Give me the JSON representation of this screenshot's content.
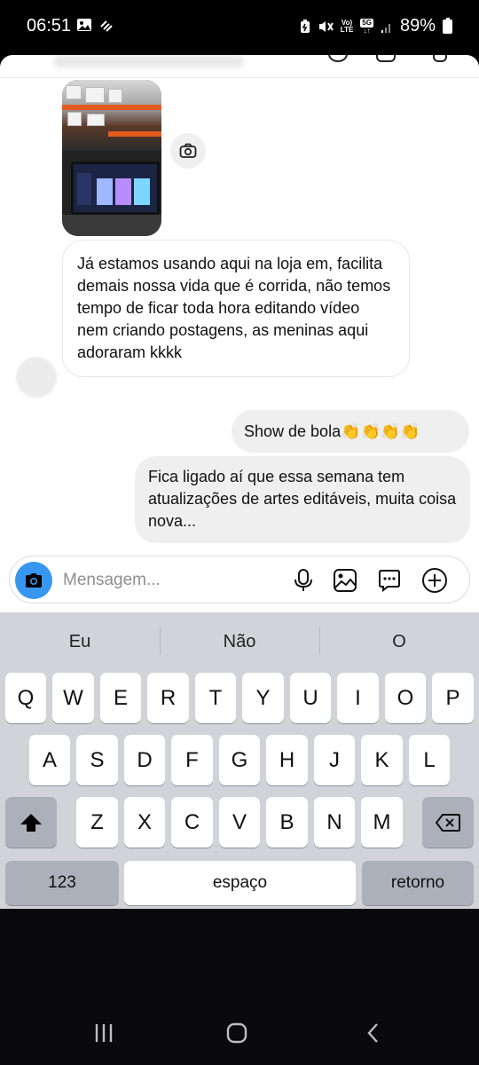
{
  "status_bar": {
    "time": "06:51",
    "battery": "89%",
    "network": "5G",
    "volte_top": "Vo)",
    "volte_bottom": "LTE"
  },
  "messages": {
    "incoming_text": "Já estamos usando aqui na loja em, facilita demais nossa vida que é corrida, não temos tempo de ficar toda hora editando vídeo nem criando postagens, as meninas aqui adoraram kkkk",
    "outgoing_1": "Show de bola👏👏👏👏",
    "outgoing_2": "Fica ligado aí que essa semana tem atualizações de artes editáveis, muita coisa nova..."
  },
  "composer": {
    "placeholder": "Mensagem..."
  },
  "keyboard": {
    "suggestions": [
      "Eu",
      "Não",
      "O"
    ],
    "row1": [
      "Q",
      "W",
      "E",
      "R",
      "T",
      "Y",
      "U",
      "I",
      "O",
      "P"
    ],
    "row2": [
      "A",
      "S",
      "D",
      "F",
      "G",
      "H",
      "J",
      "K",
      "L"
    ],
    "row3": [
      "Z",
      "X",
      "C",
      "V",
      "B",
      "N",
      "M"
    ],
    "numbers_key": "123",
    "space_key": "espaço",
    "return_key": "retorno"
  },
  "colors": {
    "accent_blue": "#3797f0",
    "keyboard_bg": "#d1d3d9",
    "bubble_out": "#efefef"
  }
}
